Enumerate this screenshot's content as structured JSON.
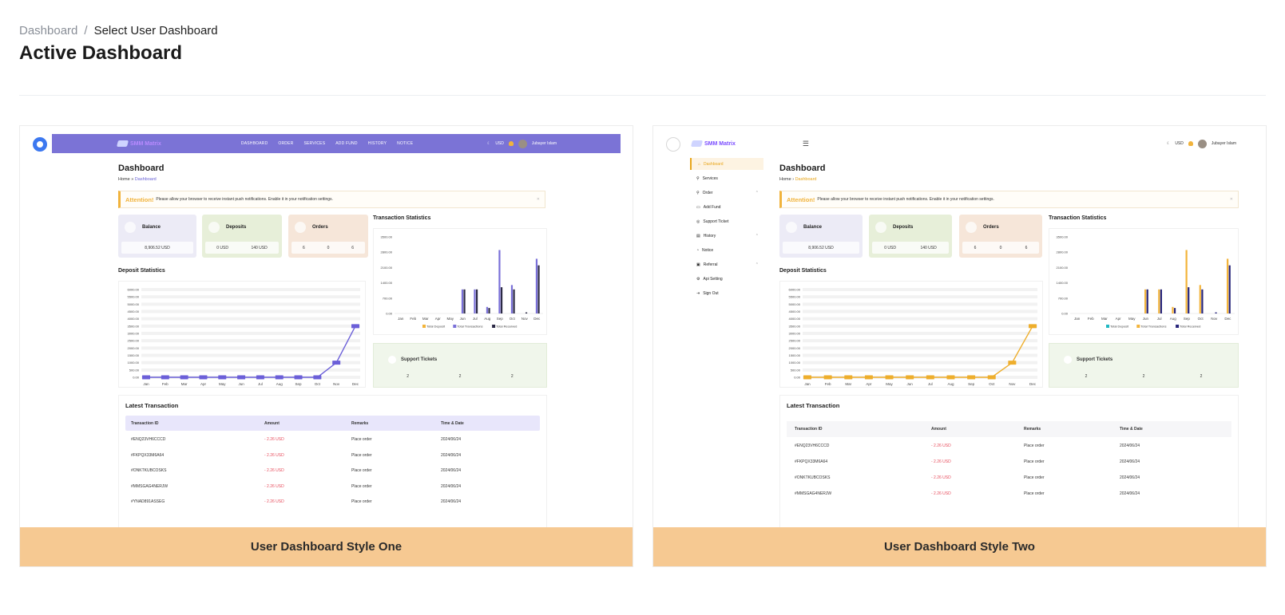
{
  "breadcrumb": {
    "root": "Dashboard",
    "sep": "/",
    "current": "Select User Dashboard"
  },
  "title": "Active Dashboard",
  "cards": [
    {
      "label": "User Dashboard Style One",
      "selected": true
    },
    {
      "label": "User Dashboard Style Two",
      "selected": false
    }
  ],
  "mini": {
    "logo": "SMM Matrix",
    "nav": [
      "DASHBOARD",
      "ORDER",
      "SERVICES",
      "ADD FUND",
      "HISTORY",
      "NOTICE"
    ],
    "currency": "USD",
    "user": "Jubayer Islam",
    "dash_title": "Dashboard",
    "crumb_home": "Home",
    "crumb_current": "Dashboard",
    "alert_title": "Attention!",
    "alert_text": "Please allow your browser to receive instant push notifications. Enable it in your notification settings.",
    "balance": {
      "label": "Balance",
      "value": "8,906.52 USD"
    },
    "deposits": {
      "label": "Deposits",
      "v1": "0 USD",
      "v2": "140 USD"
    },
    "orders": {
      "label": "Orders",
      "v1": "6",
      "v2": "0",
      "v3": "6"
    },
    "transaction_stats": "Transaction Statistics",
    "deposit_stats": "Deposit Statistics",
    "support": {
      "label": "Support Tickets",
      "v1": "2",
      "v2": "2",
      "v3": "2"
    },
    "latest": "Latest Transaction",
    "cols": [
      "Transaction ID",
      "Amount",
      "Remarks",
      "Time & Date"
    ],
    "rows": [
      [
        "#ENQ23VH6CCCD",
        "- 2.26 USD",
        "Place order",
        "2024/06/24"
      ],
      [
        "#FKPQX33M6A64",
        "- 2.26 USD",
        "Place order",
        "2024/06/24"
      ],
      [
        "#ONKTKUBCOSKS",
        "- 2.26 USD",
        "Place order",
        "2024/06/24"
      ],
      [
        "#MMSGAG4NERJW",
        "- 2.26 USD",
        "Place order",
        "2024/06/24"
      ],
      [
        "#YNAD891ASSEG",
        "- 2.26 USD",
        "Place order",
        "2024/06/24"
      ]
    ],
    "sidebar": [
      "Dashboard",
      "Services",
      "Order",
      "Add Fund",
      "Support Ticket",
      "History",
      "Notice",
      "Referral",
      "Api Setting",
      "Sign Out"
    ]
  },
  "chart_data": [
    {
      "type": "line",
      "title": "Deposit Statistics",
      "categories": [
        "Jan",
        "Feb",
        "Mar",
        "Apr",
        "May",
        "Jun",
        "Jul",
        "Aug",
        "Sep",
        "Oct",
        "Nov",
        "Dec"
      ],
      "values": [
        0,
        0,
        0,
        0,
        0,
        0,
        0,
        0,
        0,
        0,
        1000,
        3500
      ],
      "yticks": [
        "0.00",
        "500.00",
        "1000.00",
        "1500.00",
        "2000.00",
        "2500.00",
        "3000.00",
        "3500.00",
        "4000.00",
        "4500.00",
        "5000.00",
        "5500.00",
        "6000.00"
      ],
      "ylim": [
        0,
        6000
      ]
    },
    {
      "type": "bar",
      "title": "Transaction Statistics",
      "categories": [
        "Jan",
        "Feb",
        "Mar",
        "Apr",
        "May",
        "Jun",
        "Jul",
        "Aug",
        "Sep",
        "Oct",
        "Nov",
        "Dec"
      ],
      "yticks": [
        "0.00",
        "700.00",
        "1400.00",
        "2100.00",
        "2800.00",
        "3500.00"
      ],
      "ylim": [
        0,
        3500
      ],
      "series": [
        {
          "name": "Total Deposit",
          "values": [
            0,
            0,
            0,
            0,
            0,
            0,
            0,
            0,
            0,
            0,
            0,
            0
          ]
        },
        {
          "name": "Total Transactions",
          "values": [
            0,
            0,
            0,
            0,
            0,
            1100,
            1100,
            300,
            2900,
            1300,
            0,
            2500
          ]
        },
        {
          "name": "Total Received",
          "values": [
            0,
            0,
            0,
            0,
            0,
            1100,
            1100,
            250,
            1200,
            1100,
            50,
            2200
          ]
        }
      ]
    }
  ]
}
